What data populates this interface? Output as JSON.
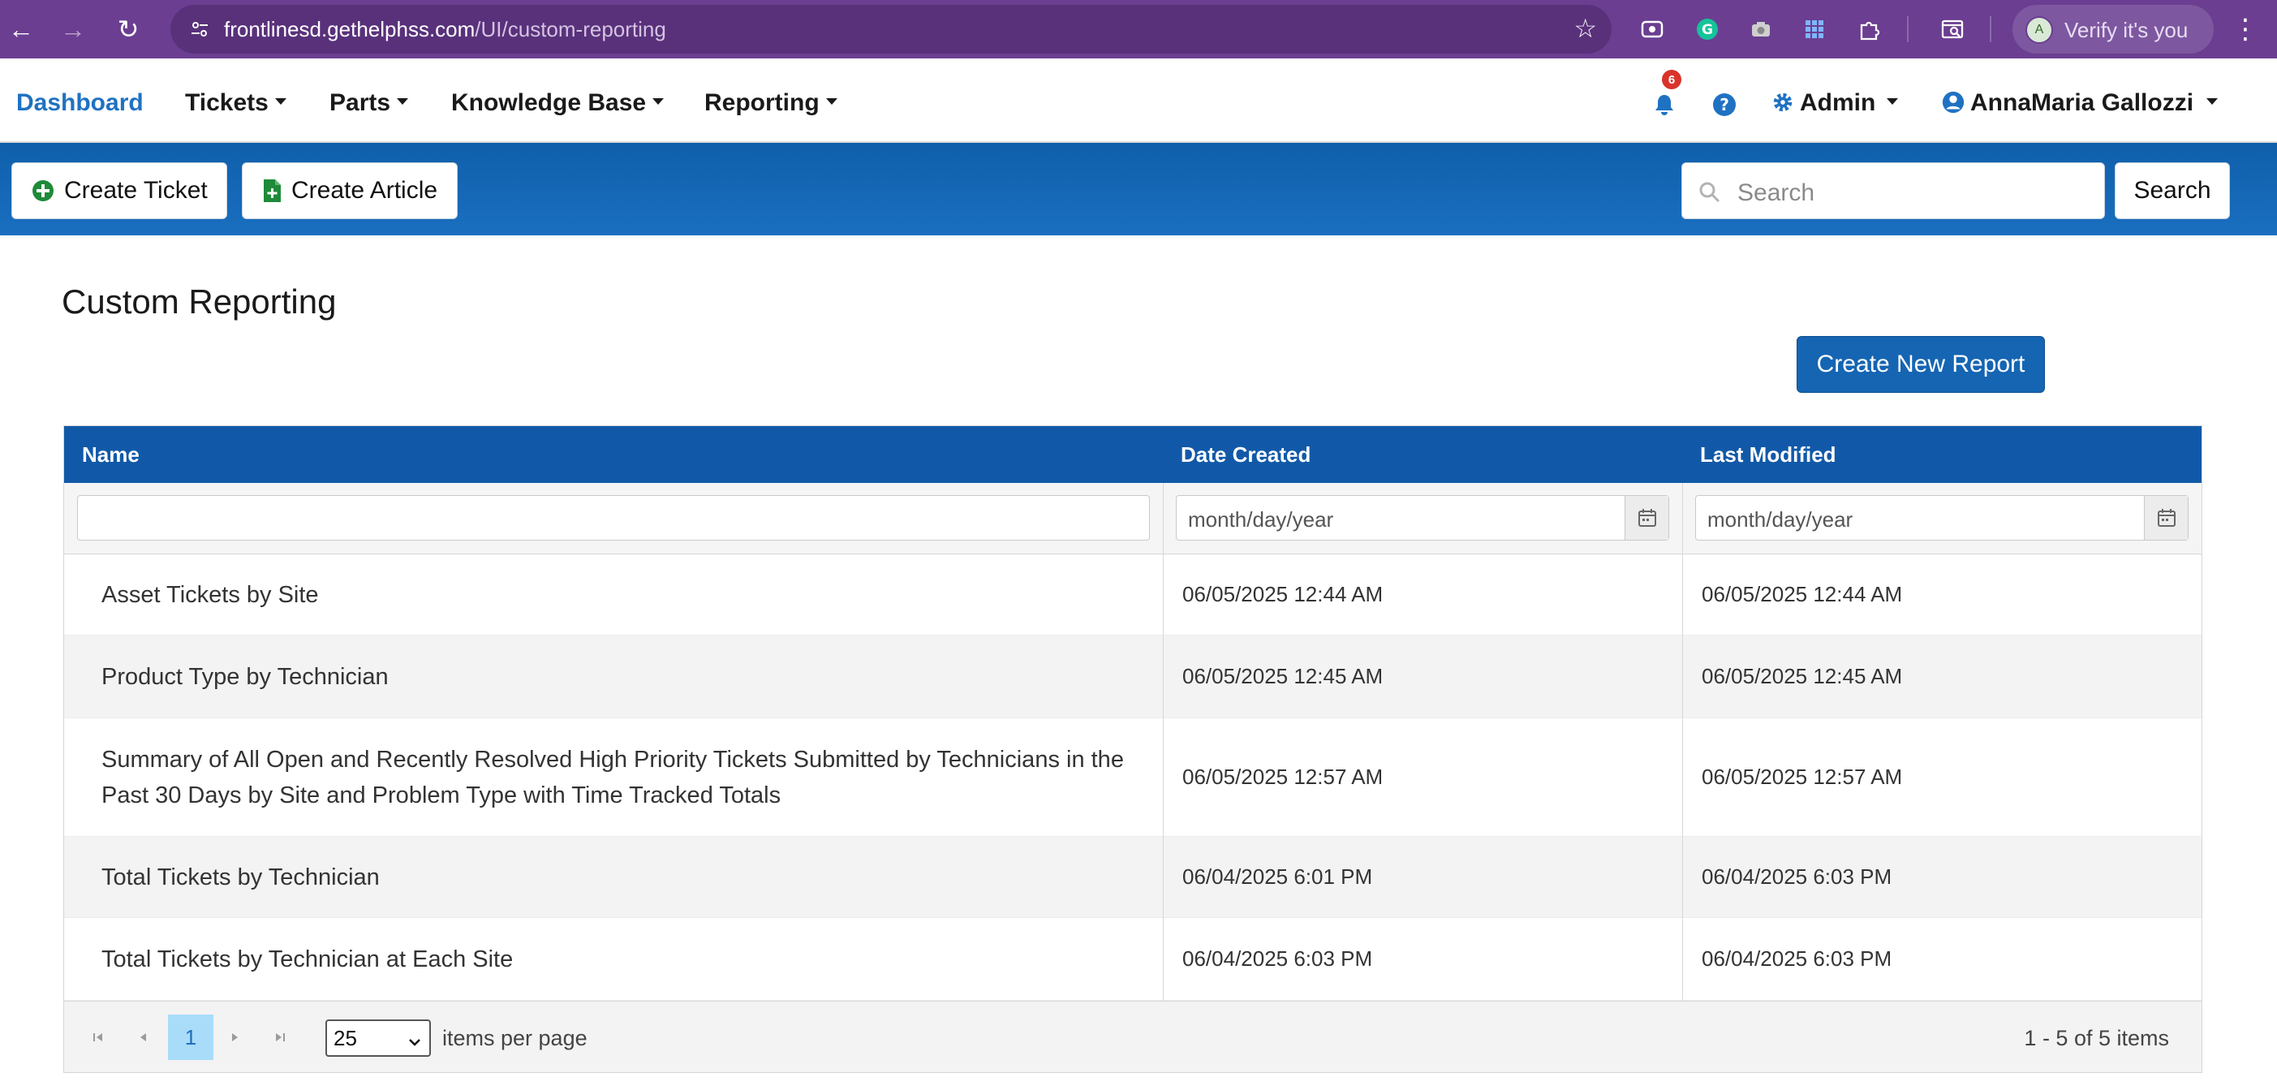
{
  "browser": {
    "url_host": "frontlinesd.gethelphss.com",
    "url_path": "/UI/custom-reporting",
    "profile_initial": "A",
    "profile_label": "Verify it's you"
  },
  "nav": {
    "dashboard": "Dashboard",
    "tickets": "Tickets",
    "parts": "Parts",
    "knowledge_base": "Knowledge Base",
    "reporting": "Reporting",
    "notification_count": "6",
    "admin": "Admin",
    "user": "AnnaMaria Gallozzi"
  },
  "toolbar": {
    "create_ticket": "Create Ticket",
    "create_article": "Create Article",
    "search_placeholder": "Search",
    "search_button": "Search"
  },
  "page": {
    "title": "Custom Reporting",
    "create_report": "Create New Report"
  },
  "grid": {
    "columns": [
      "Name",
      "Date Created",
      "Last Modified"
    ],
    "date_placeholder": "month/day/year",
    "rows": [
      {
        "name": "Asset Tickets by Site",
        "created": "06/05/2025 12:44 AM",
        "modified": "06/05/2025 12:44 AM"
      },
      {
        "name": "Product Type by Technician",
        "created": "06/05/2025 12:45 AM",
        "modified": "06/05/2025 12:45 AM"
      },
      {
        "name": "Summary of All Open and Recently Resolved High Priority Tickets Submitted by Technicians in the Past 30 Days by Site and Problem Type with Time Tracked Totals",
        "created": "06/05/2025 12:57 AM",
        "modified": "06/05/2025 12:57 AM"
      },
      {
        "name": "Total Tickets by Technician",
        "created": "06/04/2025 6:01 PM",
        "modified": "06/04/2025 6:03 PM"
      },
      {
        "name": "Total Tickets by Technician at Each Site",
        "created": "06/04/2025 6:03 PM",
        "modified": "06/04/2025 6:03 PM"
      }
    ]
  },
  "pager": {
    "current_page": "1",
    "page_size": "25",
    "items_per_page_label": "items per page",
    "count_label": "1 - 5 of 5 items"
  },
  "colors": {
    "chrome": "#6b3e91",
    "brand_blue": "#1565b3",
    "link_blue": "#1f72c2",
    "badge_red": "#d9332b",
    "create_ticket_icon": "#1e8a3a",
    "create_article_icon": "#1e8a3a"
  },
  "icons": [
    "back-icon",
    "forward-icon",
    "reload-icon",
    "site-settings-icon",
    "bookmark-star-icon",
    "bell-icon",
    "help-icon",
    "gear-icon",
    "user-circle-icon",
    "plus-circle-icon",
    "document-plus-icon",
    "search-icon",
    "calendar-icon"
  ]
}
